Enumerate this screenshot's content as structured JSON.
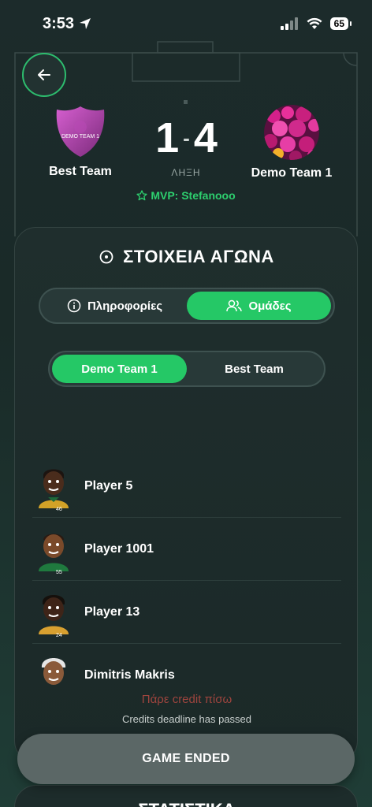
{
  "status_bar": {
    "time": "3:53",
    "battery": "65"
  },
  "match": {
    "home_team": "Best Team",
    "away_team": "Demo Team 1",
    "home_badge_text": "DEMO TEAM 1",
    "home_score": "1",
    "separator": "-",
    "away_score": "4",
    "status": "ΛΗΞΗ",
    "mvp": "MVP: Stefanooo"
  },
  "details": {
    "title": "ΣΤΟΙΧΕΙΑ ΑΓΩΝΑ",
    "tabs": [
      {
        "label": "Πληροφορίες",
        "active": false
      },
      {
        "label": "Ομάδες",
        "active": true
      }
    ],
    "team_tabs": [
      {
        "label": "Demo Team 1",
        "active": true
      },
      {
        "label": "Best Team",
        "active": false
      }
    ],
    "players": [
      {
        "name": "Player 5",
        "number": "46"
      },
      {
        "name": "Player 1001",
        "number": "55"
      },
      {
        "name": "Player 13",
        "number": "24"
      },
      {
        "name": "Dimitris Makris",
        "number": ""
      }
    ],
    "credit_link": "Πάρε credit πίσω",
    "credit_note": "Credits deadline has passed"
  },
  "actions": {
    "game_ended": "GAME ENDED"
  },
  "next_section": {
    "title": "ΣΤΑΤΙΣΤΙΚΑ"
  },
  "colors": {
    "accent": "#25c866",
    "background": "#1c2b2b",
    "danger": "#a0453e"
  }
}
